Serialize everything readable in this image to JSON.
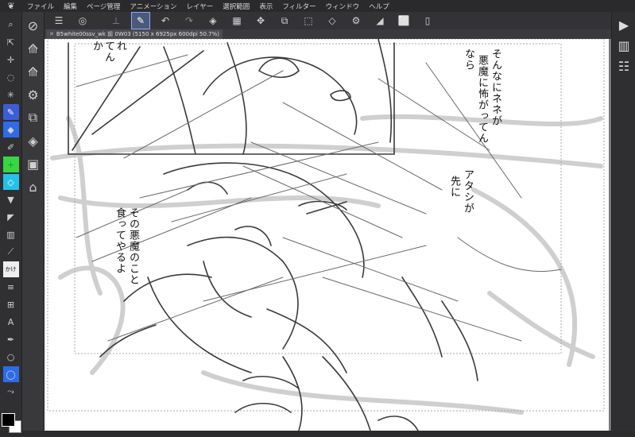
{
  "menu": {
    "items": [
      "ファイル",
      "編集",
      "ページ管理",
      "アニメーション",
      "レイヤー",
      "選択範囲",
      "表示",
      "フィルター",
      "ウィンドウ",
      "ヘルプ"
    ]
  },
  "document_tab": {
    "title": "B5white00ssv_wk 前 0W03 (5150 x 6925px 600dpi 50.7%)"
  },
  "tool_labels": {
    "text_tool": "A",
    "balloon_label": "かけ"
  },
  "colors": {
    "main_color": "#000000",
    "sub_color": "#ffffff",
    "accent": "#3d5dd8"
  },
  "canvas_text": {
    "top_left_fragment": "れ\nてん\nか",
    "top_right_line1": "そんなにネネが",
    "top_right_line2": "悪魔に怖がってん",
    "top_right_line3": "なら",
    "mid_right_line1": "アタシが",
    "mid_right_line2": "先に",
    "left_line1": "その悪魔のこと",
    "left_line2": "食ってやるよ"
  }
}
